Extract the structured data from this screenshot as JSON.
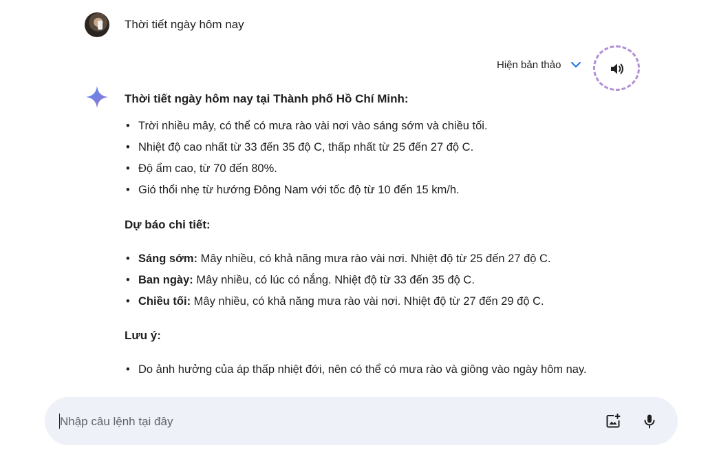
{
  "user": {
    "query": "Thời tiết ngày hôm nay"
  },
  "response_header": {
    "drafts_label": "Hiện bản thảo",
    "drafts_icon": "chevron-down-icon",
    "speaker_icon": "speaker-icon",
    "highlight_color": "#b28ed6"
  },
  "response": {
    "heading": "Thời tiết ngày hôm nay tại Thành phố Hồ Chí Minh:",
    "summary_bullets": [
      "Trời nhiều mây, có thể có mưa rào vài nơi vào sáng sớm và chiều tối.",
      "Nhiệt độ cao nhất từ 33 đến 35 độ C, thấp nhất từ 25 đến 27 độ C.",
      "Độ ẩm cao, từ 70 đến 80%.",
      "Gió thổi nhẹ từ hướng Đông Nam với tốc độ từ 10 đến 15 km/h."
    ],
    "detail_heading": "Dự báo chi tiết:",
    "detail_bullets": [
      {
        "term": "Sáng sớm:",
        "text": " Mây nhiều, có khả năng mưa rào vài nơi. Nhiệt độ từ 25 đến 27 độ C."
      },
      {
        "term": "Ban ngày:",
        "text": " Mây nhiều, có lúc có nắng. Nhiệt độ từ 33 đến 35 độ C."
      },
      {
        "term": "Chiều tối:",
        "text": " Mây nhiều, có khả năng mưa rào vài nơi. Nhiệt độ từ 27 đến 29 độ C."
      }
    ],
    "note_heading": "Lưu ý:",
    "note_bullets": [
      "Do ảnh hưởng của áp thấp nhiệt đới, nên có thể có mưa rào và giông vào ngày hôm nay."
    ]
  },
  "input": {
    "placeholder": "Nhập câu lệnh tại đây",
    "value": "",
    "image_upload_icon": "image-upload-icon",
    "mic_icon": "mic-icon"
  },
  "colors": {
    "input_background": "#eef2f8",
    "sparkle_gradient": [
      "#4f8cf7",
      "#9b72cb"
    ]
  }
}
